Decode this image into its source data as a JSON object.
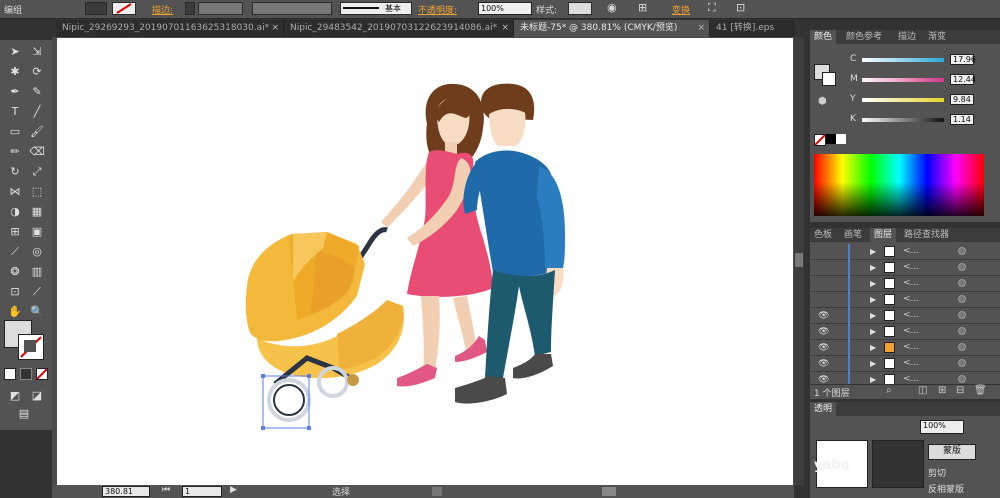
{
  "control_bar": {
    "mode_label": "编组",
    "stroke_label": "描边:",
    "stroke_style_label": "基本",
    "opacity_label": "不透明度:",
    "opacity_value": "100%",
    "style_label": "样式:",
    "transform_label": "变换"
  },
  "tabs": [
    {
      "label": "Nipic_29269293_20190701163625318030.ai*",
      "close": "×"
    },
    {
      "label": "Nipic_29483542_20190703122623914086.ai*",
      "close": "×"
    },
    {
      "label": "未标题-75* @ 380.81% (CMYK/预览)",
      "close": "×"
    },
    {
      "label": "41 [转换].eps",
      "close": ""
    }
  ],
  "status": {
    "zoom": "380.81",
    "page": "1",
    "tool": "选择"
  },
  "color_panel": {
    "tabs": [
      "颜色",
      "颜色参考",
      "描边",
      "渐变"
    ],
    "sliders": [
      {
        "label": "C",
        "value": "17.96",
        "color": "#29a8d6"
      },
      {
        "label": "M",
        "value": "12.44",
        "color": "#d6338c"
      },
      {
        "label": "Y",
        "value": "9.84",
        "color": "#e6d429"
      },
      {
        "label": "K",
        "value": "1.14",
        "color": "#111111"
      }
    ]
  },
  "layers_panel": {
    "tabs": [
      "色板",
      "画笔",
      "图层",
      "路径查找器"
    ],
    "rows": [
      {
        "eye": "",
        "name": "<..."
      },
      {
        "eye": "",
        "name": "<..."
      },
      {
        "eye": "",
        "name": "<..."
      },
      {
        "eye": "",
        "name": "<..."
      },
      {
        "eye": "👁",
        "name": "<..."
      },
      {
        "eye": "👁",
        "name": "<..."
      },
      {
        "eye": "👁",
        "name": "<..."
      },
      {
        "eye": "👁",
        "name": "<..."
      },
      {
        "eye": "👁",
        "name": "<..."
      }
    ],
    "footer": "1 个图层"
  },
  "transparency_panel": {
    "tab": "透明",
    "opacity_value": "100%",
    "button": "蒙版",
    "clip_label": "剪切",
    "invert_label": "反相蒙版"
  },
  "watermark": "yabo"
}
